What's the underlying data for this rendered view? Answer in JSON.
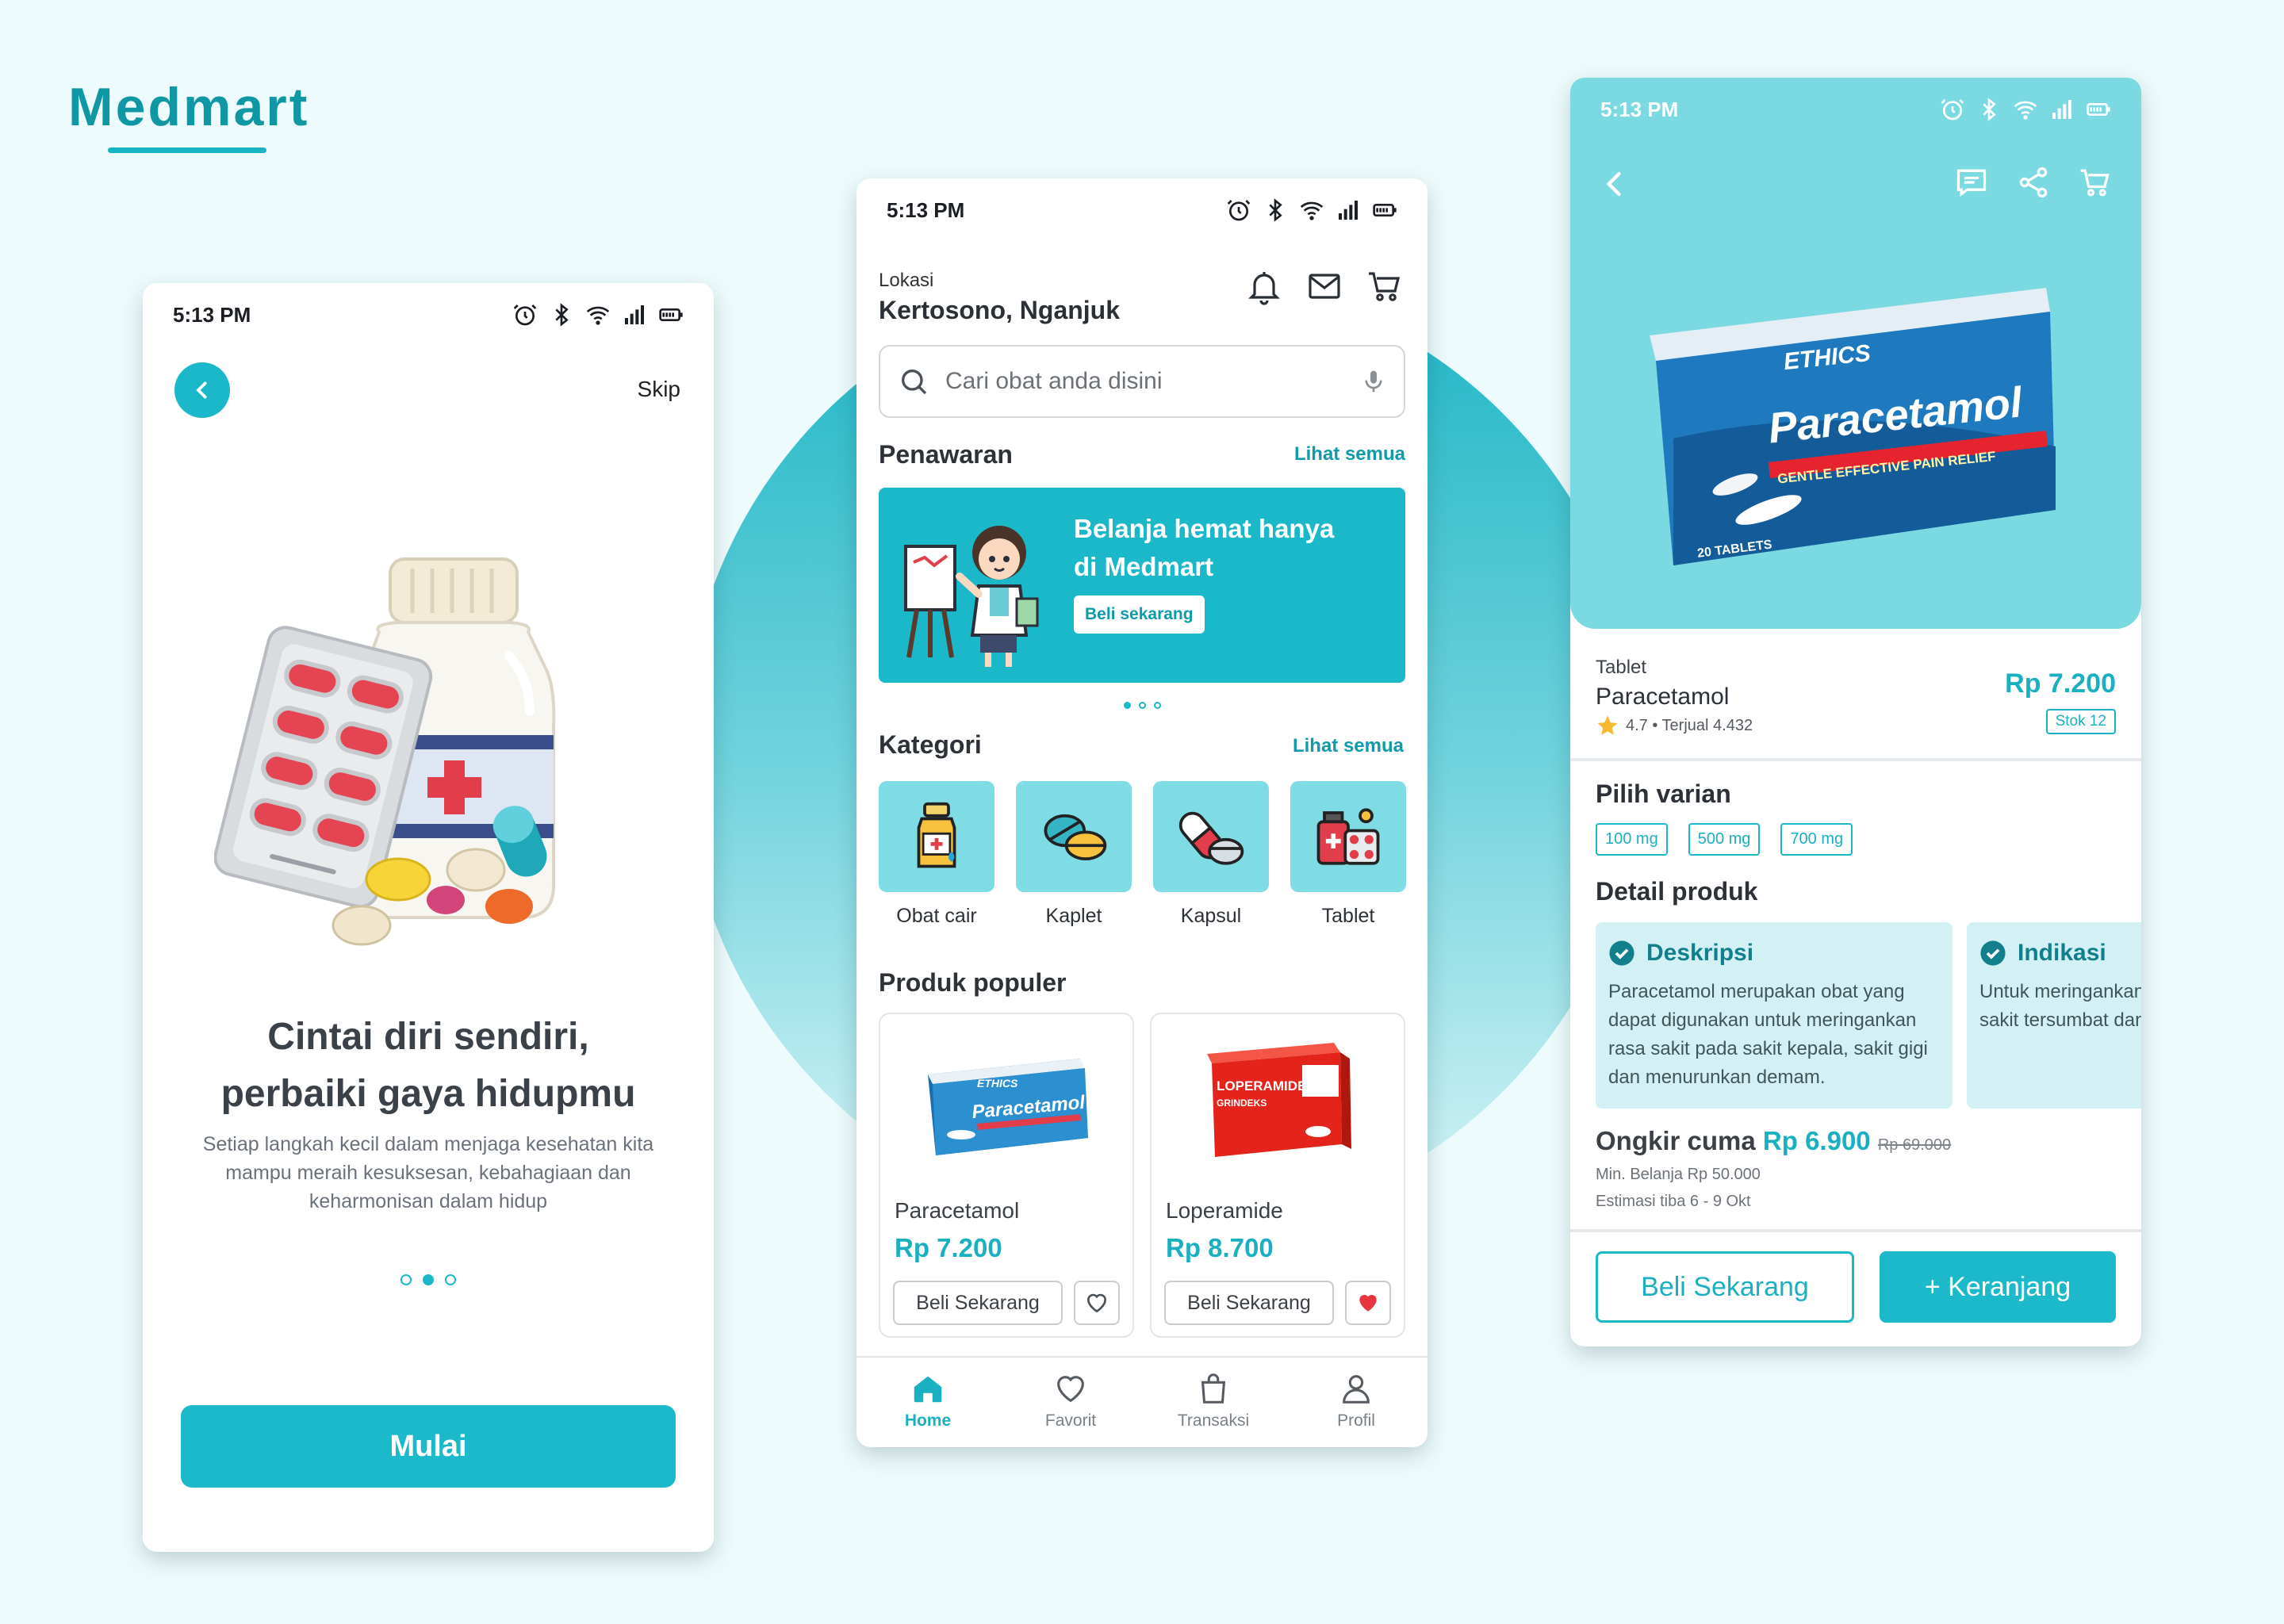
{
  "brand": {
    "name": "Medmart"
  },
  "colors": {
    "primary": "#1ab8c8",
    "accent_dark": "#0f97a4",
    "background": "#eefbfc"
  },
  "onboarding": {
    "status_time": "5:13 PM",
    "skip_label": "Skip",
    "title_line1": "Cintai diri sendiri,",
    "title_line2": "perbaiki gaya hidupmu",
    "description": "Setiap langkah kecil dalam menjaga kesehatan kita mampu meraih kesuksesan, kebahagiaan dan keharmonisan dalam hidup",
    "page_indicator": {
      "count": 3,
      "active": 2
    },
    "start_label": "Mulai"
  },
  "home": {
    "status_time": "5:13 PM",
    "location_label": "Lokasi",
    "location_value": "Kertosono, Nganjuk",
    "search_placeholder": "Cari obat anda disini",
    "offers_title": "Penawaran",
    "see_all": "Lihat semua",
    "banner_line1": "Belanja hemat hanya",
    "banner_line2": "di Medmart",
    "banner_button": "Beli sekarang",
    "categories_title": "Kategori",
    "categories": [
      {
        "label": "Obat cair",
        "icon": "syrup-bottle-icon"
      },
      {
        "label": "Kaplet",
        "icon": "caplet-icon"
      },
      {
        "label": "Kapsul",
        "icon": "capsule-icon"
      },
      {
        "label": "Tablet",
        "icon": "tablet-box-icon"
      }
    ],
    "popular_title": "Produk populer",
    "products": [
      {
        "name": "Paracetamol",
        "price": "Rp 7.200",
        "buy_label": "Beli Sekarang",
        "favorited": false,
        "box_brand": "ETHICS",
        "box_name": "Paracetamol"
      },
      {
        "name": "Loperamide",
        "price": "Rp 8.700",
        "buy_label": "Beli Sekarang",
        "favorited": true,
        "box_brand": "LOPERAMIDE",
        "box_name": "GRINDEKS"
      }
    ],
    "tabs": [
      {
        "label": "Home",
        "icon": "home-icon",
        "active": true
      },
      {
        "label": "Favorit",
        "icon": "heart-icon",
        "active": false
      },
      {
        "label": "Transaksi",
        "icon": "bag-icon",
        "active": false
      },
      {
        "label": "Profil",
        "icon": "user-icon",
        "active": false
      }
    ]
  },
  "detail": {
    "status_time": "5:13 PM",
    "product_image": {
      "brand": "ETHICS",
      "name": "Paracetamol",
      "tagline": "GENTLE EFFECTIVE PAIN RELIEF",
      "count": "20 TABLETS"
    },
    "type": "Tablet",
    "name": "Paracetamol",
    "rating_text": "4.7 • Terjual 4.432",
    "price": "Rp 7.200",
    "stock": "Stok 12",
    "variants_title": "Pilih varian",
    "variants": [
      "100 mg",
      "500 mg",
      "700 mg"
    ],
    "details_title": "Detail produk",
    "details": [
      {
        "title": "Deskripsi",
        "text": "Paracetamol merupakan obat yang dapat digunakan untuk meringankan rasa sakit pada sakit kepala, sakit gigi dan menurunkan demam."
      },
      {
        "title": "Indikasi",
        "text": "Untuk meringankan seperti demam, sakit tersumbat dan ber batuk."
      }
    ],
    "shipping_label": "Ongkir cuma",
    "shipping_price": "Rp 6.900",
    "shipping_old": "Rp 69.000",
    "min_purchase": "Min. Belanja Rp 50.000",
    "eta": "Estimasi tiba 6 - 9 Okt",
    "buy_now": "Beli Sekarang",
    "add_cart": "+ Keranjang"
  }
}
